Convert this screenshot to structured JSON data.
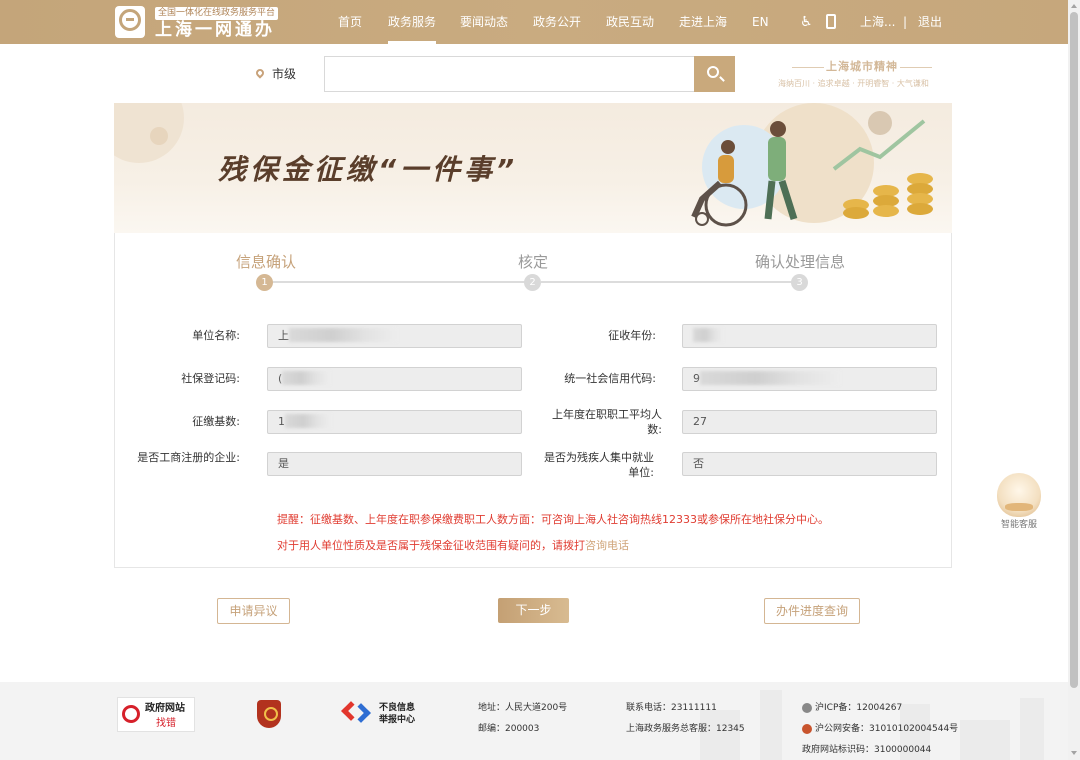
{
  "header": {
    "logo_tagline": "全国一体化在线政务服务平台",
    "logo_title": "上海一网通办",
    "nav": [
      "首页",
      "政务服务",
      "要闻动态",
      "政务公开",
      "政民互动",
      "走进上海",
      "EN"
    ],
    "active_nav": "政务服务",
    "user": "上海...",
    "separator": "|",
    "logout": "退出",
    "icons": [
      "accessibility-icon",
      "mobile-icon"
    ]
  },
  "search": {
    "location": "市级",
    "placeholder": "",
    "value": ""
  },
  "city_spirit": {
    "title": "上海城市精神",
    "subtitle": "海纳百川 · 追求卓越 · 开明睿智 · 大气谦和"
  },
  "banner": {
    "title": "残保金征缴“一件事”"
  },
  "steps": [
    {
      "label": "信息确认",
      "number": "1",
      "state": "active"
    },
    {
      "label": "核定",
      "number": "2",
      "state": "pending"
    },
    {
      "label": "确认处理信息",
      "number": "3",
      "state": "pending"
    }
  ],
  "form": {
    "unit_name": {
      "label": "单位名称:",
      "value": "上"
    },
    "collect_year": {
      "label": "征收年份:",
      "value": ""
    },
    "social_reg": {
      "label": "社保登记码:",
      "value": "("
    },
    "credit_code": {
      "label": "统一社会信用代码:",
      "value": "9"
    },
    "base": {
      "label": "征缴基数:",
      "value": "1"
    },
    "avg_employees": {
      "label": "上年度在职职工平均人数:",
      "value": "27"
    },
    "registered": {
      "label": "是否工商注册的企业:",
      "value": "是"
    },
    "disabled_center": {
      "label": "是否为残疾人集中就业单位:",
      "value": "否"
    }
  },
  "tips": {
    "line1": "提醒：征缴基数、上年度在职参保缴费职工人数方面：可咨询上海人社咨询热线12333或参保所在地社保分中心。",
    "line2_prefix": "对于用人单位性质及是否属于残保金征收范围有疑问的，请拨打",
    "line2_link": "咨询电话"
  },
  "buttons": {
    "appeal": "申请异议",
    "next": "下一步",
    "progress": "办件进度查询"
  },
  "assistant": {
    "label": "智能客服"
  },
  "footer": {
    "gov_site": "政府网站",
    "find_error": "找错",
    "report_center": "不良信息举报中心",
    "address": "地址：人民大道200号",
    "postcode": "邮编：200003",
    "phone": "联系电话：23111111",
    "hotline": "上海政务服务总客服：12345",
    "icp": "沪ICP备：12004267",
    "police": "沪公网安备：31010102004544号",
    "site_id": "政府网站标识码：3100000044"
  },
  "colors": {
    "header_gold": "#c4a57a",
    "accent_gold": "#c6a27a",
    "warning_red": "#e03c31",
    "inactive_step": "#dcdcdc"
  }
}
